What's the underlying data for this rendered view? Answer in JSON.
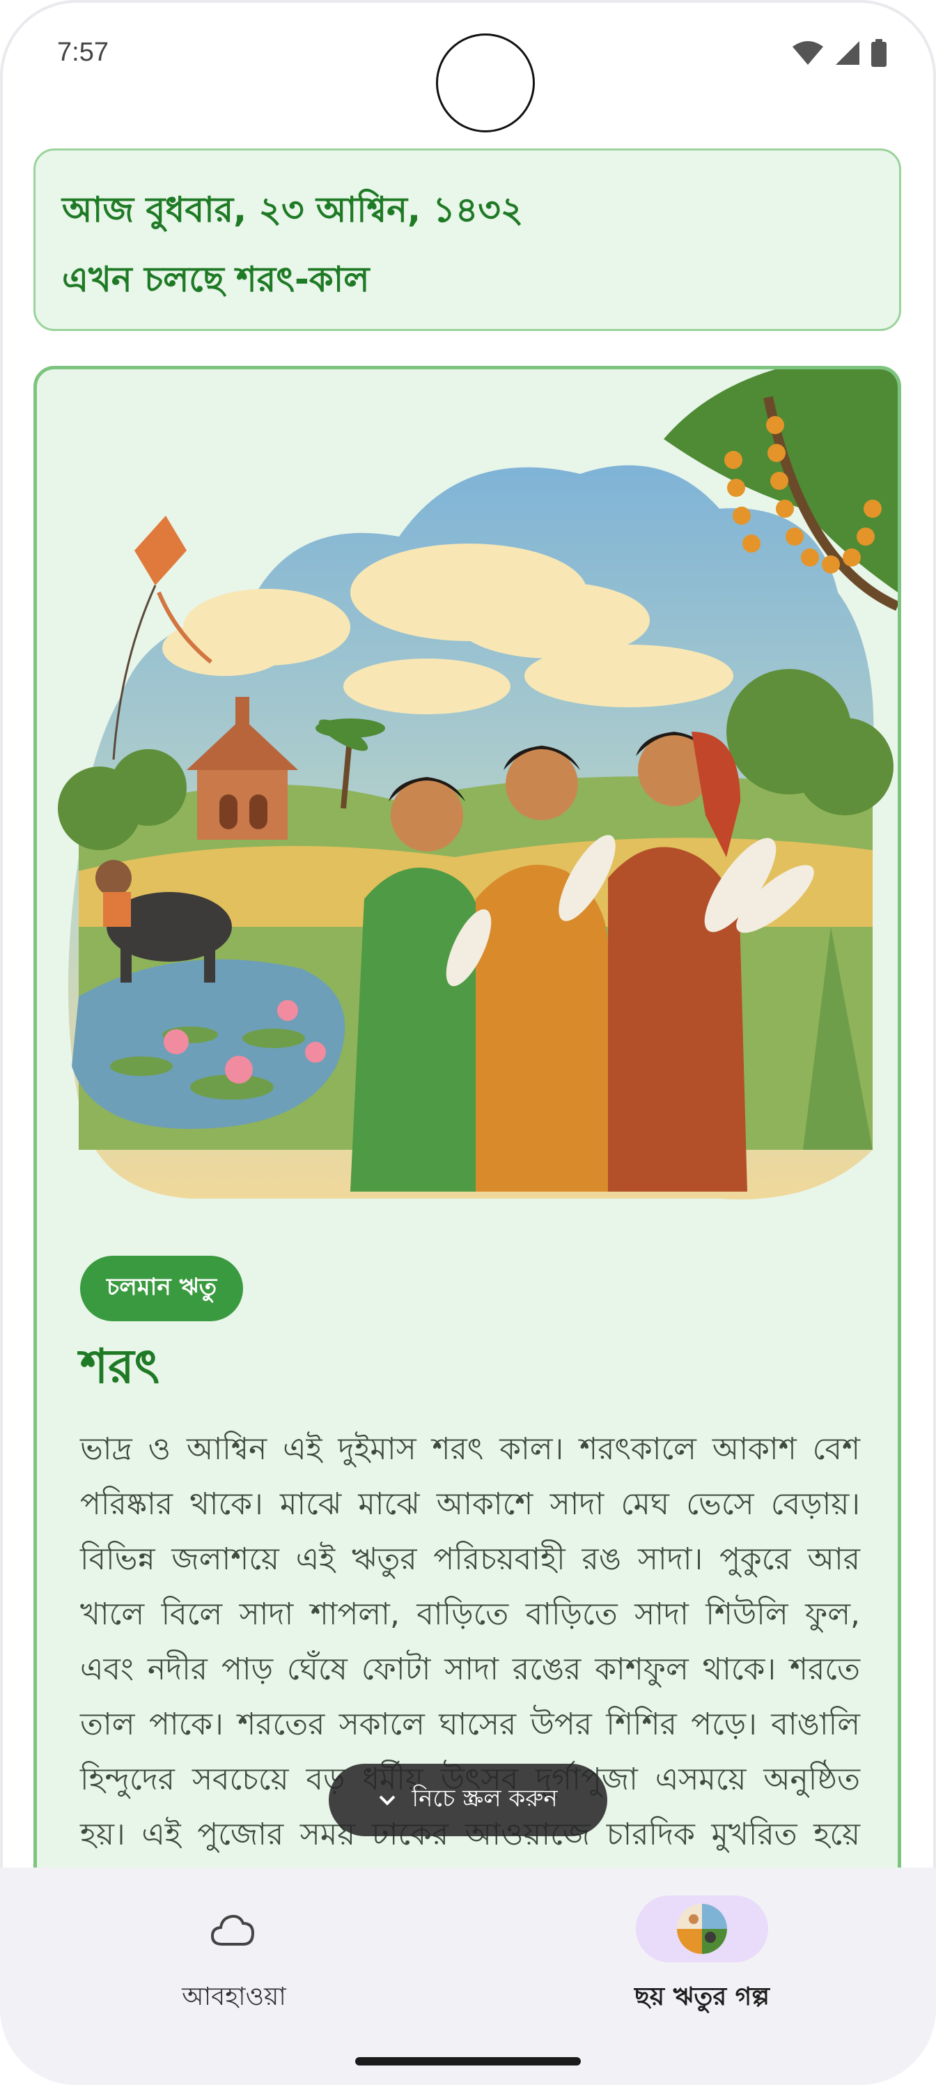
{
  "status_bar": {
    "time": "7:57"
  },
  "date_card": {
    "line1": "আজ বুধবার, ২৩ আশ্বিন, ১৪৩২",
    "line2": "এখন চলছে শরৎ-কাল"
  },
  "season": {
    "chip": "চলমান ঋতু",
    "title": "শরৎ",
    "description": "ভাদ্র ও আশ্বিন এই দুইমাস শরৎ কাল। শরৎকালে আকাশ বেশ পরিষ্কার থাকে। মাঝে মাঝে আকাশে সাদা মেঘ ভেসে বেড়ায়। বিভিন্ন জলাশয়ে এই ঋতুর পরিচয়বাহী রঙ সাদা। পুকুরে আর খালে বিলে সাদা শাপলা, বাড়িতে বাড়িতে সাদা শিউলি ফুল, এবং নদীর পাড় ঘেঁষে ফোটা সাদা রঙের কাশফুল থাকে। শরতে তাল পাকে। শরতের সকালে ঘাসের উপর শিশির পড়ে। বাঙালি হিন্দুদের সবচেয়ে বড় ধর্মীয় উৎসব দূর্গাপুজা এসময়ে অনুষ্ঠিত হয়। এই পুজোর সময় ঢাকের আওয়াজে চারদিক মুখরিত হয়ে ওঠে। শরৎ যেন"
  },
  "scroll_hint": {
    "label": "নিচে স্ক্রল করুন",
    "icon": "chevron-down-icon"
  },
  "bottom_nav": {
    "items": [
      {
        "label": "আবহাওয়া",
        "icon": "cloud-icon",
        "active": false
      },
      {
        "label": "ছয় ঋতুর গল্প",
        "icon": "seasons-icon",
        "active": true
      }
    ]
  },
  "colors": {
    "accent": "#1f7a25",
    "chip_bg": "#3a9a40",
    "card_bg": "#e8f5e9",
    "nav_active_bg": "#e9dcfb"
  }
}
